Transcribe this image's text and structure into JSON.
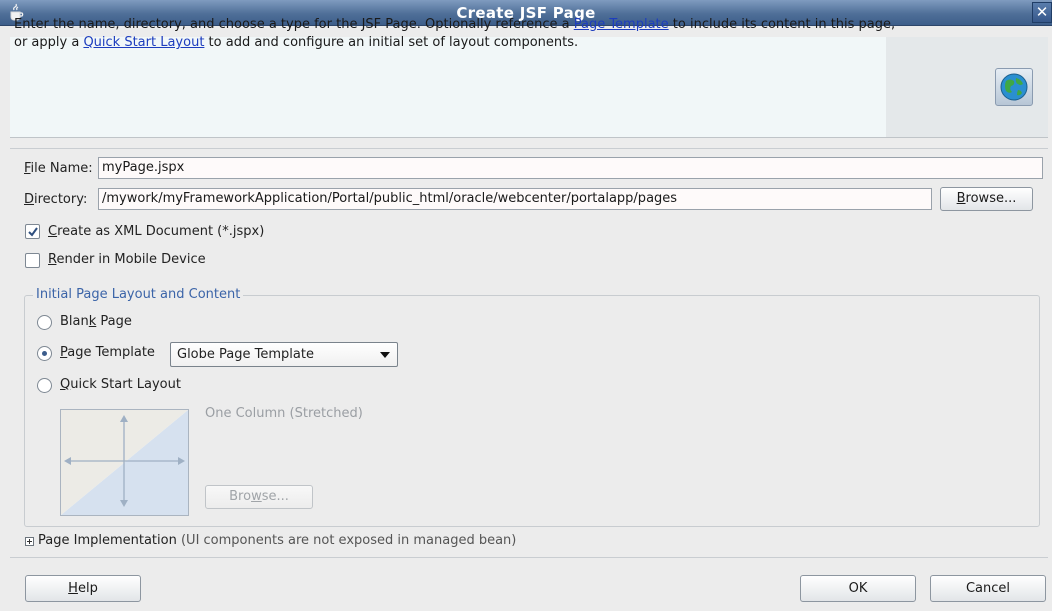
{
  "window": {
    "title": "Create JSF Page",
    "close_glyph": "✕"
  },
  "header": {
    "desc_part1": "Enter the name, directory, and choose a type for the JSF Page. Optionally reference a ",
    "link_page_template": "Page Template",
    "desc_part2": " to include its content in this page,",
    "desc_part3": "or apply a ",
    "link_quick_start": "Quick Start Layout",
    "desc_part4": " to add and configure an initial set of layout components.",
    "icon": "globe-icon"
  },
  "form": {
    "file_name_label_first": "F",
    "file_name_label_rest": "ile Name:",
    "file_name_value": "myPage.jspx",
    "directory_label_first": "D",
    "directory_label_rest": "irectory:",
    "directory_value": "/mywork/myFrameworkApplication/Portal/public_html/oracle/webcenter/portalapp/pages",
    "browse_label_first": "B",
    "browse_label_rest": "rowse...",
    "create_xml_first": "C",
    "create_xml_rest": "reate as XML Document (*.jspx)",
    "create_xml_checked": true,
    "render_mobile_first": "R",
    "render_mobile_rest": "ender in Mobile Device",
    "render_mobile_checked": false
  },
  "layout_group": {
    "title": "Initial Page Layout and Content",
    "blank_page_a": "Blan",
    "blank_page_u": "k",
    "blank_page_b": " Page",
    "page_template_first": "P",
    "page_template_rest": "age Template",
    "page_template_selected": "Globe Page Template",
    "quick_start_first": "Q",
    "quick_start_rest": "uick Start Layout",
    "selected_option": "page_template",
    "layout_name": "One Column (Stretched)",
    "browse_a": "Bro",
    "browse_u": "w",
    "browse_b": "se..."
  },
  "page_impl": {
    "label": "Page Implementation",
    "note": " (UI components are not exposed in managed bean)"
  },
  "footer": {
    "help_first": "H",
    "help_rest": "elp",
    "ok": "OK",
    "cancel": "Cancel"
  },
  "colors": {
    "title_bar": "#4f6f98",
    "link": "#1d3dbe",
    "group_title": "#3b64a8"
  }
}
